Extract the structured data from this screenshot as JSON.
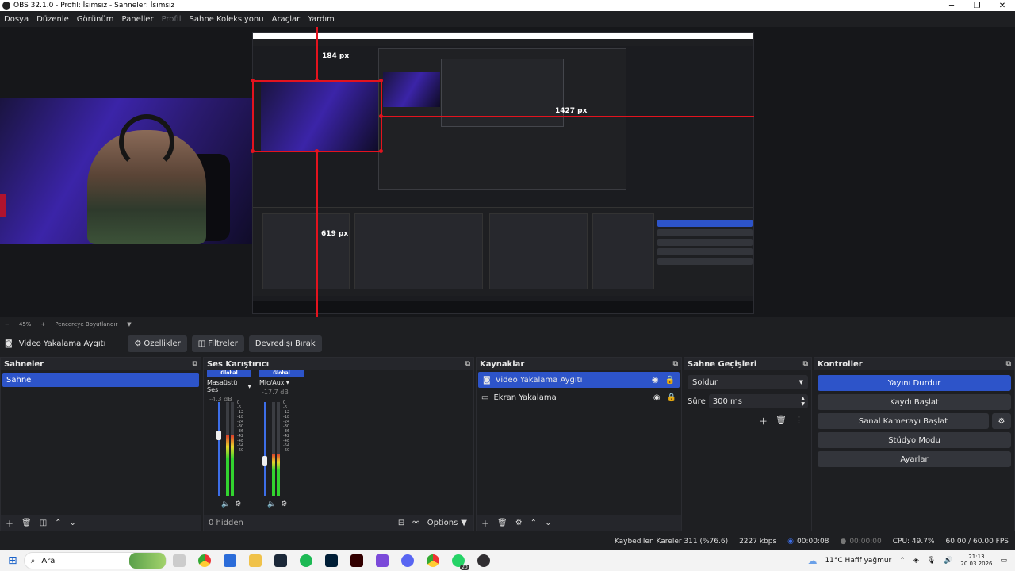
{
  "window": {
    "title": "OBS 32.1.0 - Profil: İsimsiz - Sahneler: İsimsiz"
  },
  "menu": [
    "Dosya",
    "Düzenle",
    "Görünüm",
    "Paneller",
    "Profil",
    "Sahne Koleksiyonu",
    "Araçlar",
    "Yardım"
  ],
  "preview": {
    "zoom": "45%",
    "fit_label": "Pencereye Boyutlandır",
    "measure_top": "184 px",
    "measure_right": "1427 px",
    "measure_bottom": "619 px"
  },
  "context_bar": {
    "source_name": "Video Yakalama Aygıtı",
    "properties": "Özellikler",
    "filters": "Filtreler",
    "deactivate": "Devredışı Bırak"
  },
  "scenes": {
    "title": "Sahneler",
    "items": [
      "Sahne"
    ]
  },
  "mixer": {
    "title": "Ses Karıştırıcı",
    "channels": [
      {
        "tag": "Global",
        "name": "Masaüstü Ses",
        "db": "-4.3 dB",
        "level": 0.65
      },
      {
        "tag": "Global",
        "name": "Mic/Aux",
        "db": "-17.7 dB",
        "level": 0.45
      }
    ],
    "scale": [
      "0",
      "-6",
      "-12",
      "-18",
      "-24",
      "-30",
      "-36",
      "-42",
      "-48",
      "-54",
      "-60"
    ],
    "hidden": "0 hidden",
    "options": "Options"
  },
  "sources": {
    "title": "Kaynaklar",
    "items": [
      {
        "name": "Video Yakalama Aygıtı",
        "selected": true
      },
      {
        "name": "Ekran Yakalama",
        "selected": false
      }
    ]
  },
  "transitions": {
    "title": "Sahne Geçişleri",
    "selected": "Soldur",
    "duration_label": "Süre",
    "duration": "300 ms"
  },
  "controls": {
    "title": "Kontroller",
    "stop_stream": "Yayını Durdur",
    "start_record": "Kaydı Başlat",
    "virtual_cam": "Sanal Kamerayı Başlat",
    "studio_mode": "Stüdyo Modu",
    "settings": "Ayarlar"
  },
  "status": {
    "dropped": "Kaybedilen Kareler 311 (%76.6)",
    "bitrate": "2227 kbps",
    "stream_time": "00:00:08",
    "record_time": "00:00:00",
    "cpu": "CPU: 49.7%",
    "fps": "60.00 / 60.00 FPS"
  },
  "taskbar": {
    "search": "Ara",
    "weather": "11°C  Hafif yağmur",
    "time": "21:13",
    "date": "20.03.2026",
    "badge": "20"
  },
  "colors": {
    "accent": "#2d54c9",
    "measure": "#e3131e"
  }
}
